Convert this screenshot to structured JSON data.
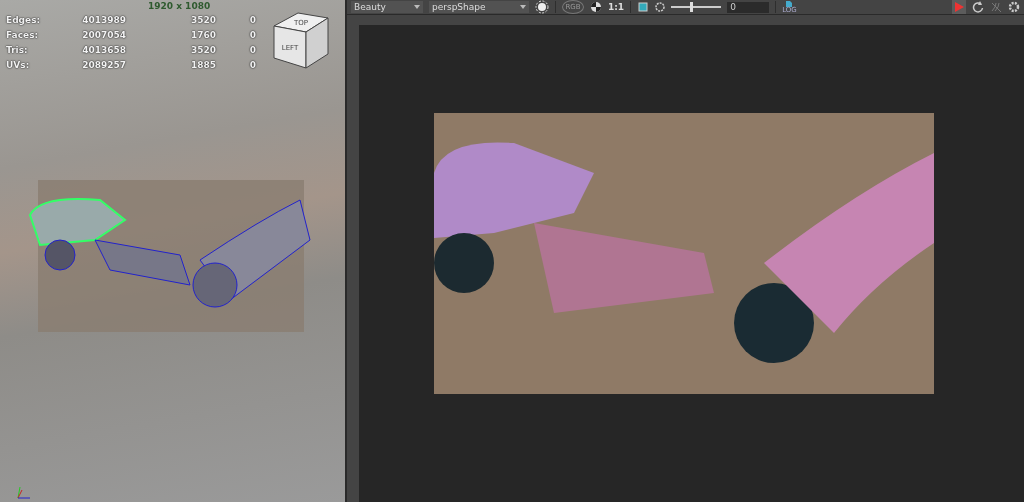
{
  "viewport": {
    "stats": [
      {
        "label": "Edges:",
        "value": "4013989",
        "selected_value": "3520",
        "extra": "0"
      },
      {
        "label": "Faces:",
        "value": "2007054",
        "selected_value": "1760",
        "extra": "0"
      },
      {
        "label": "Tris:",
        "value": "4013658",
        "selected_value": "3520",
        "extra": "0"
      },
      {
        "label": "UVs:",
        "value": "2089257",
        "selected_value": "1885",
        "extra": "0"
      }
    ],
    "resolution": "1920 x 1080",
    "view_cube": {
      "top": "TOP",
      "side": "LEFT"
    }
  },
  "render_view": {
    "toolbar": {
      "pass": "Beauty",
      "camera": "perspShape",
      "channel_badge": "RGB",
      "zoom": "1:1",
      "exposure": {
        "level": 0.4,
        "value": "0"
      },
      "log_badge": "LOG",
      "rendering": true
    }
  }
}
